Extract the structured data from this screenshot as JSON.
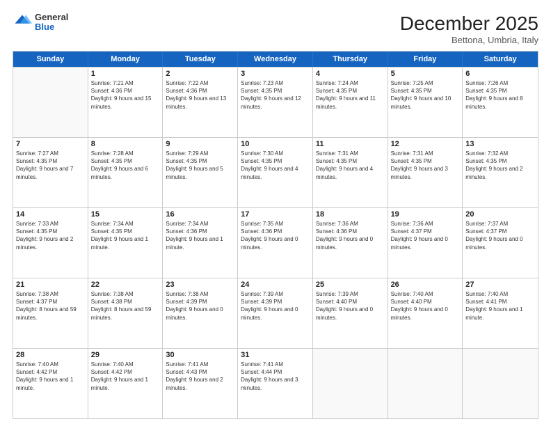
{
  "header": {
    "logo": {
      "general": "General",
      "blue": "Blue"
    },
    "title": "December 2025",
    "location": "Bettona, Umbria, Italy"
  },
  "days_of_week": [
    "Sunday",
    "Monday",
    "Tuesday",
    "Wednesday",
    "Thursday",
    "Friday",
    "Saturday"
  ],
  "weeks": [
    [
      {
        "day": "",
        "empty": true
      },
      {
        "day": "1",
        "sunrise": "Sunrise: 7:21 AM",
        "sunset": "Sunset: 4:36 PM",
        "daylight": "Daylight: 9 hours and 15 minutes."
      },
      {
        "day": "2",
        "sunrise": "Sunrise: 7:22 AM",
        "sunset": "Sunset: 4:36 PM",
        "daylight": "Daylight: 9 hours and 13 minutes."
      },
      {
        "day": "3",
        "sunrise": "Sunrise: 7:23 AM",
        "sunset": "Sunset: 4:35 PM",
        "daylight": "Daylight: 9 hours and 12 minutes."
      },
      {
        "day": "4",
        "sunrise": "Sunrise: 7:24 AM",
        "sunset": "Sunset: 4:35 PM",
        "daylight": "Daylight: 9 hours and 11 minutes."
      },
      {
        "day": "5",
        "sunrise": "Sunrise: 7:25 AM",
        "sunset": "Sunset: 4:35 PM",
        "daylight": "Daylight: 9 hours and 10 minutes."
      },
      {
        "day": "6",
        "sunrise": "Sunrise: 7:26 AM",
        "sunset": "Sunset: 4:35 PM",
        "daylight": "Daylight: 9 hours and 8 minutes."
      }
    ],
    [
      {
        "day": "7",
        "sunrise": "Sunrise: 7:27 AM",
        "sunset": "Sunset: 4:35 PM",
        "daylight": "Daylight: 9 hours and 7 minutes."
      },
      {
        "day": "8",
        "sunrise": "Sunrise: 7:28 AM",
        "sunset": "Sunset: 4:35 PM",
        "daylight": "Daylight: 9 hours and 6 minutes."
      },
      {
        "day": "9",
        "sunrise": "Sunrise: 7:29 AM",
        "sunset": "Sunset: 4:35 PM",
        "daylight": "Daylight: 9 hours and 5 minutes."
      },
      {
        "day": "10",
        "sunrise": "Sunrise: 7:30 AM",
        "sunset": "Sunset: 4:35 PM",
        "daylight": "Daylight: 9 hours and 4 minutes."
      },
      {
        "day": "11",
        "sunrise": "Sunrise: 7:31 AM",
        "sunset": "Sunset: 4:35 PM",
        "daylight": "Daylight: 9 hours and 4 minutes."
      },
      {
        "day": "12",
        "sunrise": "Sunrise: 7:31 AM",
        "sunset": "Sunset: 4:35 PM",
        "daylight": "Daylight: 9 hours and 3 minutes."
      },
      {
        "day": "13",
        "sunrise": "Sunrise: 7:32 AM",
        "sunset": "Sunset: 4:35 PM",
        "daylight": "Daylight: 9 hours and 2 minutes."
      }
    ],
    [
      {
        "day": "14",
        "sunrise": "Sunrise: 7:33 AM",
        "sunset": "Sunset: 4:35 PM",
        "daylight": "Daylight: 9 hours and 2 minutes."
      },
      {
        "day": "15",
        "sunrise": "Sunrise: 7:34 AM",
        "sunset": "Sunset: 4:35 PM",
        "daylight": "Daylight: 9 hours and 1 minute."
      },
      {
        "day": "16",
        "sunrise": "Sunrise: 7:34 AM",
        "sunset": "Sunset: 4:36 PM",
        "daylight": "Daylight: 9 hours and 1 minute."
      },
      {
        "day": "17",
        "sunrise": "Sunrise: 7:35 AM",
        "sunset": "Sunset: 4:36 PM",
        "daylight": "Daylight: 9 hours and 0 minutes."
      },
      {
        "day": "18",
        "sunrise": "Sunrise: 7:36 AM",
        "sunset": "Sunset: 4:36 PM",
        "daylight": "Daylight: 9 hours and 0 minutes."
      },
      {
        "day": "19",
        "sunrise": "Sunrise: 7:36 AM",
        "sunset": "Sunset: 4:37 PM",
        "daylight": "Daylight: 9 hours and 0 minutes."
      },
      {
        "day": "20",
        "sunrise": "Sunrise: 7:37 AM",
        "sunset": "Sunset: 4:37 PM",
        "daylight": "Daylight: 9 hours and 0 minutes."
      }
    ],
    [
      {
        "day": "21",
        "sunrise": "Sunrise: 7:38 AM",
        "sunset": "Sunset: 4:37 PM",
        "daylight": "Daylight: 8 hours and 59 minutes."
      },
      {
        "day": "22",
        "sunrise": "Sunrise: 7:38 AM",
        "sunset": "Sunset: 4:38 PM",
        "daylight": "Daylight: 8 hours and 59 minutes."
      },
      {
        "day": "23",
        "sunrise": "Sunrise: 7:38 AM",
        "sunset": "Sunset: 4:39 PM",
        "daylight": "Daylight: 9 hours and 0 minutes."
      },
      {
        "day": "24",
        "sunrise": "Sunrise: 7:39 AM",
        "sunset": "Sunset: 4:39 PM",
        "daylight": "Daylight: 9 hours and 0 minutes."
      },
      {
        "day": "25",
        "sunrise": "Sunrise: 7:39 AM",
        "sunset": "Sunset: 4:40 PM",
        "daylight": "Daylight: 9 hours and 0 minutes."
      },
      {
        "day": "26",
        "sunrise": "Sunrise: 7:40 AM",
        "sunset": "Sunset: 4:40 PM",
        "daylight": "Daylight: 9 hours and 0 minutes."
      },
      {
        "day": "27",
        "sunrise": "Sunrise: 7:40 AM",
        "sunset": "Sunset: 4:41 PM",
        "daylight": "Daylight: 9 hours and 1 minute."
      }
    ],
    [
      {
        "day": "28",
        "sunrise": "Sunrise: 7:40 AM",
        "sunset": "Sunset: 4:42 PM",
        "daylight": "Daylight: 9 hours and 1 minute."
      },
      {
        "day": "29",
        "sunrise": "Sunrise: 7:40 AM",
        "sunset": "Sunset: 4:42 PM",
        "daylight": "Daylight: 9 hours and 1 minute."
      },
      {
        "day": "30",
        "sunrise": "Sunrise: 7:41 AM",
        "sunset": "Sunset: 4:43 PM",
        "daylight": "Daylight: 9 hours and 2 minutes."
      },
      {
        "day": "31",
        "sunrise": "Sunrise: 7:41 AM",
        "sunset": "Sunset: 4:44 PM",
        "daylight": "Daylight: 9 hours and 3 minutes."
      },
      {
        "day": "",
        "empty": true
      },
      {
        "day": "",
        "empty": true
      },
      {
        "day": "",
        "empty": true
      }
    ]
  ]
}
